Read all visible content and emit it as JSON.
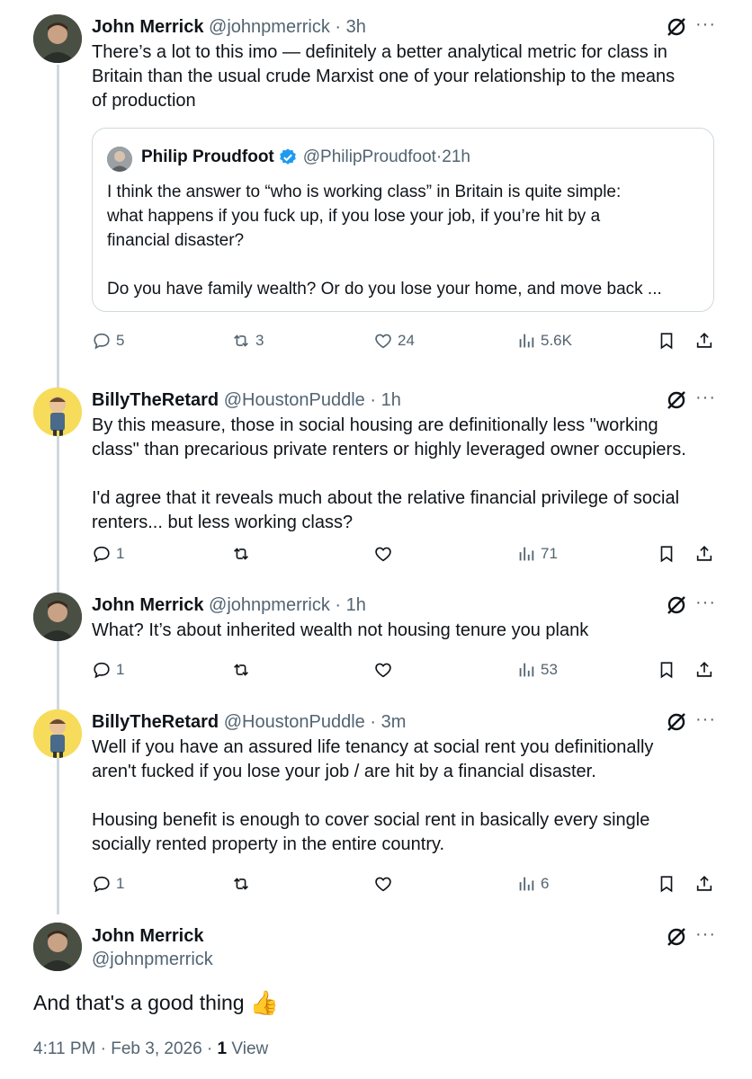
{
  "posts": [
    {
      "name": "John Merrick",
      "handle": "@johnpmerrick",
      "time": "3h",
      "text": "There’s a lot to this imo — definitely a better analytical metric for class in\nBritain than the usual crude Marxist one of your relationship to the means\nof production",
      "quote": {
        "name": "Philip Proudfoot",
        "handle": "@PhilipProudfoot",
        "time": "21h",
        "text": "I think the answer to “who is working class” in Britain is quite simple:\nwhat happens if you fuck up, if you lose your job, if you’re hit by a\nfinancial disaster?\n\nDo you have family wealth? Or do you lose your home, and move back ..."
      },
      "replies": "5",
      "reposts": "3",
      "likes": "24",
      "views": "5.6K"
    },
    {
      "name": "BillyTheRetard",
      "handle": "@HoustonPuddle",
      "time": "1h",
      "text": "By this measure, those in social housing are definitionally less \"working\nclass\" than precarious private renters or highly leveraged owner occupiers.\n\nI'd agree that it reveals much about the relative financial privilege of social\nrenters... but less working class?",
      "replies": "1",
      "reposts": "",
      "likes": "",
      "views": "71"
    },
    {
      "name": "John Merrick",
      "handle": "@johnpmerrick",
      "time": "1h",
      "text": "What? It’s about inherited wealth not housing tenure you plank",
      "replies": "1",
      "reposts": "",
      "likes": "",
      "views": "53"
    },
    {
      "name": "BillyTheRetard",
      "handle": "@HoustonPuddle",
      "time": "3m",
      "text": "Well if you have an assured life tenancy at social rent you definitionally\naren't fucked if you lose your job / are hit by a financial disaster.\n\nHousing benefit is enough to cover social rent in basically every single\nsocially rented property in the entire country.",
      "replies": "1",
      "reposts": "",
      "likes": "",
      "views": "6"
    }
  ],
  "main": {
    "name": "John Merrick",
    "handle": "@johnpmerrick",
    "text": "And that's a good thing",
    "emoji": "👍",
    "date": "4:11 PM · Feb 3, 2026 · ",
    "view_count": "1",
    "view_label": " View"
  },
  "separator": " · ",
  "more_label": "···",
  "icons": {
    "reply": "reply-icon",
    "repost": "repost-icon",
    "like": "like-icon",
    "views": "views-icon",
    "bookmark": "bookmark-icon",
    "share": "share-icon",
    "grok": "grok-icon",
    "verified": "verified-badge-icon"
  },
  "colors": {
    "text": "#0f1419",
    "secondary": "#536471",
    "border": "#cfd9de",
    "verified": "#1d9bf0"
  }
}
